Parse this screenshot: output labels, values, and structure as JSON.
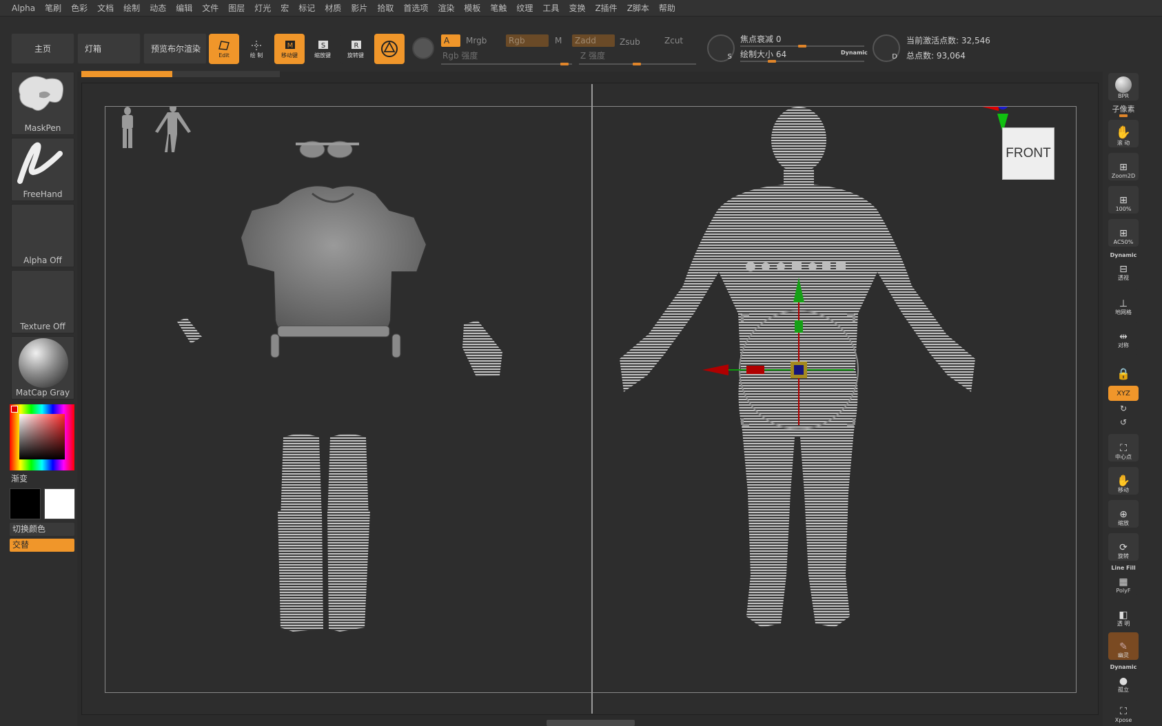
{
  "menu": [
    "Alpha",
    "笔刷",
    "色彩",
    "文档",
    "绘制",
    "动态",
    "编辑",
    "文件",
    "图层",
    "灯光",
    "宏",
    "标记",
    "材质",
    "影片",
    "拾取",
    "首选项",
    "渲染",
    "模板",
    "笔触",
    "纹理",
    "工具",
    "变换",
    "Z插件",
    "Z脚本",
    "帮助"
  ],
  "nav": {
    "home": "主页",
    "lightbox": "灯箱",
    "bpr": "预览布尔渲染"
  },
  "tools": {
    "edit": "Edit",
    "draw": "绘 制",
    "move": "移动键",
    "scale": "缩放键",
    "rotate": "旋转键"
  },
  "channels": {
    "a": "A",
    "mrgb": "Mrgb",
    "rgb": "Rgb",
    "m": "M",
    "zadd": "Zadd",
    "zsub": "Zsub",
    "zcut": "Zcut",
    "rgb_intensity": "Rgb 强度",
    "z_intensity": "Z 强度"
  },
  "brush": {
    "focal_label": "焦点衰减 0",
    "size_label": "绘制大小 64",
    "dynamic": "Dynamic",
    "focal": 0,
    "size": 64
  },
  "stats": {
    "active_points": "当前激活点数: 32,546",
    "total_points": "总点数: 93,064"
  },
  "progress": 0.46,
  "left": {
    "brush": "MaskPen",
    "stroke": "FreeHand",
    "alpha": "Alpha Off",
    "texture": "Texture Off",
    "material": "MatCap Gray",
    "gradient": "渐变",
    "switch_color": "切换颜色",
    "alternate": "交替"
  },
  "right": {
    "bpr": "BPR",
    "subpixel": "子像素",
    "scroll": "滚 动",
    "zoom2d": "Zoom2D",
    "zoom100": "100%",
    "ac50": "AC50%",
    "dynamic": "Dynamic",
    "persp": "透视",
    "floor": "地网格",
    "sym": "对称",
    "lock": "",
    "xyz": "XYZ",
    "center": "中心点",
    "move": "移动",
    "scale": "缩放",
    "rotate": "旋转",
    "linefill": "Line Fill",
    "polyf": "PolyF",
    "transp": "透 明",
    "ghost": "幽灵",
    "dynamic2": "Dynamic",
    "solo": "孤立",
    "xpose": "Xpose"
  },
  "view_label": "FRONT",
  "colors": {
    "accent": "#f0962a",
    "bg": "#2b2b2b",
    "canvas": "#2d2d2d",
    "mesh": "#bdbdbd"
  }
}
